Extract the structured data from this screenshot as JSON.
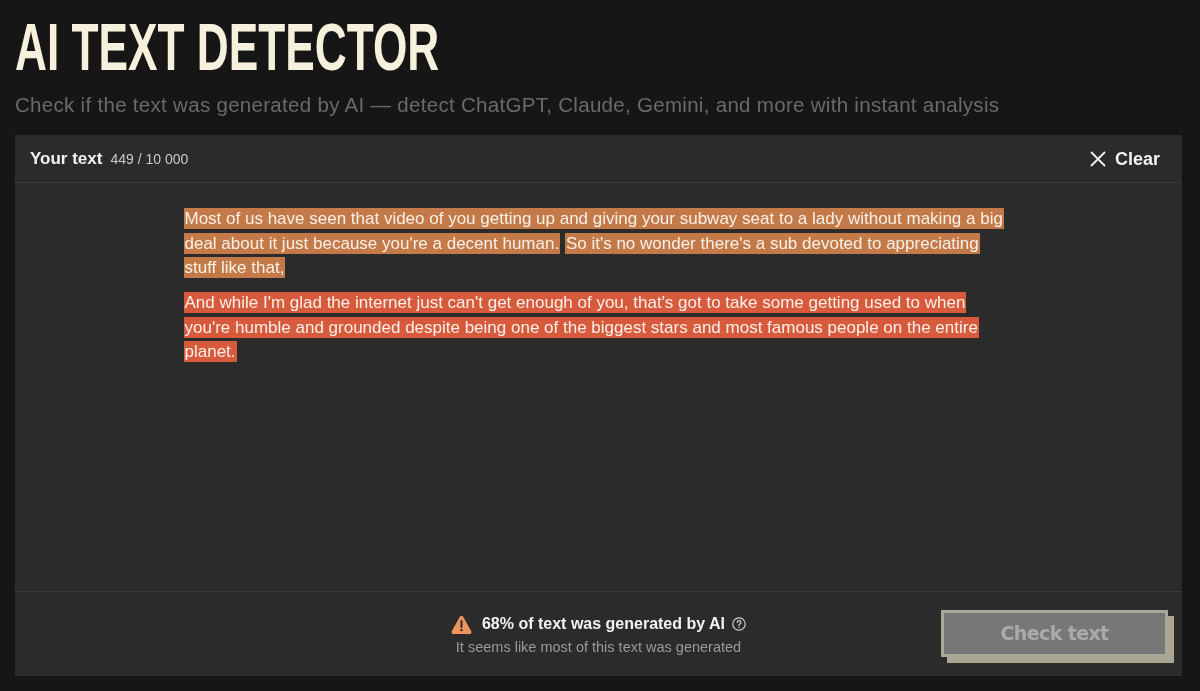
{
  "title": "AI TEXT DETECTOR",
  "subtitle": "Check if the text was generated by AI — detect ChatGPT, Claude, Gemini, and more with instant analysis",
  "editor": {
    "label": "Your text",
    "char_count": "449 / 10 000",
    "clear_button": "Clear",
    "paragraphs": [
      {
        "lines": [
          {
            "segments": [
              {
                "text": "Most of us have seen that video of you getting up and giving your subway seat to a lady without making a big",
                "color": "#c47a48"
              }
            ]
          },
          {
            "segments": [
              {
                "text": "deal about it just because you're a decent human.",
                "color": "#c47a48"
              },
              {
                "text": "So it's no wonder there's a sub devoted to appreciating",
                "color": "#c47a48"
              }
            ]
          },
          {
            "segments": [
              {
                "text": "stuff like that,",
                "color": "#c47a48"
              }
            ]
          }
        ]
      },
      {
        "lines": [
          {
            "segments": [
              {
                "text": "And while I'm glad the internet just can't get enough of you, that's got to take some getting used to when",
                "color": "#d85a3c"
              }
            ]
          },
          {
            "segments": [
              {
                "text": "you're humble and grounded despite being one of the biggest stars and most famous people on the entire",
                "color": "#d85a3c"
              }
            ]
          },
          {
            "segments": [
              {
                "text": "planet.",
                "color": "#d85a3c"
              }
            ]
          }
        ]
      }
    ]
  },
  "result": {
    "headline": "68% of text was generated by AI",
    "detail": "It seems like most of this text was generated"
  },
  "check_button": {
    "label": "Check text",
    "disabled": true
  }
}
